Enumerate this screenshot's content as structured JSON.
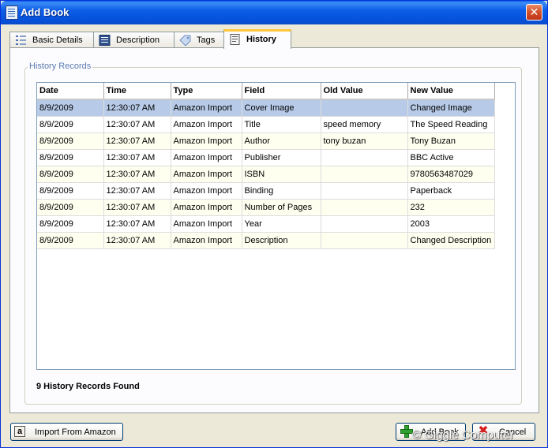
{
  "window": {
    "title": "Add Book",
    "close_label": "✕"
  },
  "tabs": [
    {
      "label": "Basic Details",
      "icon": "list-icon"
    },
    {
      "label": "Description",
      "icon": "document-icon"
    },
    {
      "label": "Tags",
      "icon": "tag-icon"
    },
    {
      "label": "History",
      "icon": "history-icon",
      "active": true
    }
  ],
  "history": {
    "group_label": "History Records",
    "columns": [
      "Date",
      "Time",
      "Type",
      "Field",
      "Old Value",
      "New Value"
    ],
    "rows": [
      {
        "date": "8/9/2009",
        "time": "12:30:07 AM",
        "type": "Amazon Import",
        "field": "Cover Image",
        "old": "",
        "new": "Changed Image"
      },
      {
        "date": "8/9/2009",
        "time": "12:30:07 AM",
        "type": "Amazon Import",
        "field": "Title",
        "old": "speed memory",
        "new": "The Speed Reading"
      },
      {
        "date": "8/9/2009",
        "time": "12:30:07 AM",
        "type": "Amazon Import",
        "field": "Author",
        "old": "tony buzan",
        "new": "Tony Buzan"
      },
      {
        "date": "8/9/2009",
        "time": "12:30:07 AM",
        "type": "Amazon Import",
        "field": "Publisher",
        "old": "",
        "new": "BBC Active"
      },
      {
        "date": "8/9/2009",
        "time": "12:30:07 AM",
        "type": "Amazon Import",
        "field": "ISBN",
        "old": "",
        "new": "9780563487029"
      },
      {
        "date": "8/9/2009",
        "time": "12:30:07 AM",
        "type": "Amazon Import",
        "field": "Binding",
        "old": "",
        "new": "Paperback"
      },
      {
        "date": "8/9/2009",
        "time": "12:30:07 AM",
        "type": "Amazon Import",
        "field": "Number of Pages",
        "old": "",
        "new": "232"
      },
      {
        "date": "8/9/2009",
        "time": "12:30:07 AM",
        "type": "Amazon Import",
        "field": "Year",
        "old": "",
        "new": "2003"
      },
      {
        "date": "8/9/2009",
        "time": "12:30:07 AM",
        "type": "Amazon Import",
        "field": "Description",
        "old": "",
        "new": "Changed Description"
      }
    ],
    "count_text": "9 History Records Found"
  },
  "buttons": {
    "import_label": "Import From Amazon",
    "amazon_glyph": "a",
    "add_label": "Add Book",
    "cancel_label": "Cancel",
    "cancel_glyph": "✖"
  },
  "watermark": "© Giggle Computer",
  "colors": {
    "title_bar": "#0551dc",
    "active_tab_accent": "#ffc83c",
    "selected_row": "#b7cbe8",
    "alt_row": "#fffff0"
  }
}
